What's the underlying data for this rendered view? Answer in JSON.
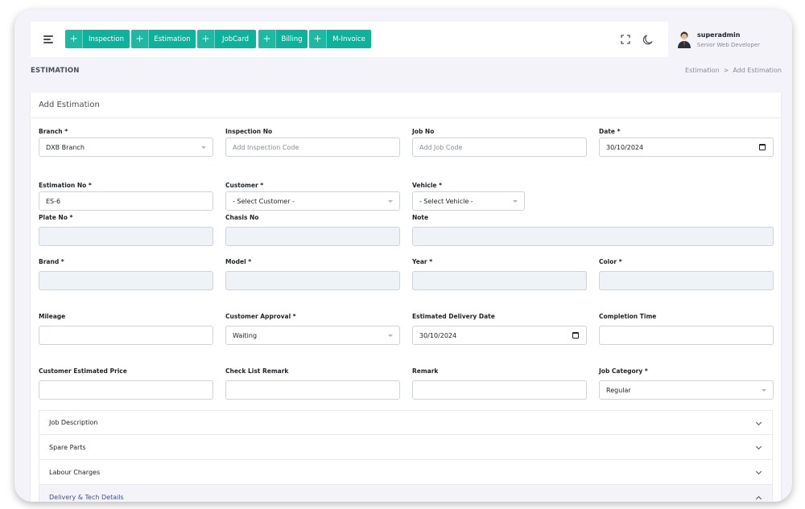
{
  "topbar": {
    "quick_actions": [
      "Inspection",
      "Estimation",
      "JobCard",
      "Billing",
      "M-Invoice"
    ],
    "user": {
      "name": "superadmin",
      "role": "Senior Web Developer"
    }
  },
  "page": {
    "title": "ESTIMATION",
    "breadcrumb": {
      "parent": "Estimation",
      "separator": ">",
      "current": "Add Estimation"
    }
  },
  "card": {
    "title": "Add Estimation"
  },
  "form": {
    "branch": {
      "label": "Branch *",
      "value": "DXB Branch"
    },
    "inspection_no": {
      "label": "Inspection No",
      "placeholder": "Add Inspection Code"
    },
    "job_no": {
      "label": "Job No",
      "placeholder": "Add Job Code"
    },
    "date": {
      "label": "Date *",
      "value": "30/10/2024"
    },
    "estimation_no": {
      "label": "Estimation No *",
      "value": "ES-6"
    },
    "customer": {
      "label": "Customer *",
      "value": "- Select Customer -"
    },
    "vehicle": {
      "label": "Vehicle *",
      "value": "- Select Vehicle -"
    },
    "plate_no": {
      "label": "Plate No *"
    },
    "chasis_no": {
      "label": "Chasis No"
    },
    "note": {
      "label": "Note"
    },
    "brand": {
      "label": "Brand *"
    },
    "model": {
      "label": "Model *"
    },
    "year": {
      "label": "Year *"
    },
    "color": {
      "label": "Color *"
    },
    "mileage": {
      "label": "Mileage"
    },
    "customer_approval": {
      "label": "Customer Approval *",
      "value": "Waiting"
    },
    "estimated_delivery_date": {
      "label": "Estimated Delivery Date",
      "value": "30/10/2024"
    },
    "completion_time": {
      "label": "Completion Time"
    },
    "customer_estimated_price": {
      "label": "Customer Estimated Price"
    },
    "check_list_remark": {
      "label": "Check List Remark"
    },
    "remark": {
      "label": "Remark"
    },
    "job_category": {
      "label": "Job Category *",
      "value": "Regular"
    }
  },
  "sections": [
    "Job Description",
    "Spare Parts",
    "Labour Charges",
    "Delivery & Tech Details"
  ],
  "colors": {
    "accent": "#0ab39c",
    "primary": "#405189",
    "background": "#f3f3f9"
  },
  "icons": [
    "hamburger-icon",
    "plus-icon",
    "fullscreen-icon",
    "moon-icon",
    "calendar-icon",
    "chevron-down-icon",
    "chevron-up-icon"
  ]
}
